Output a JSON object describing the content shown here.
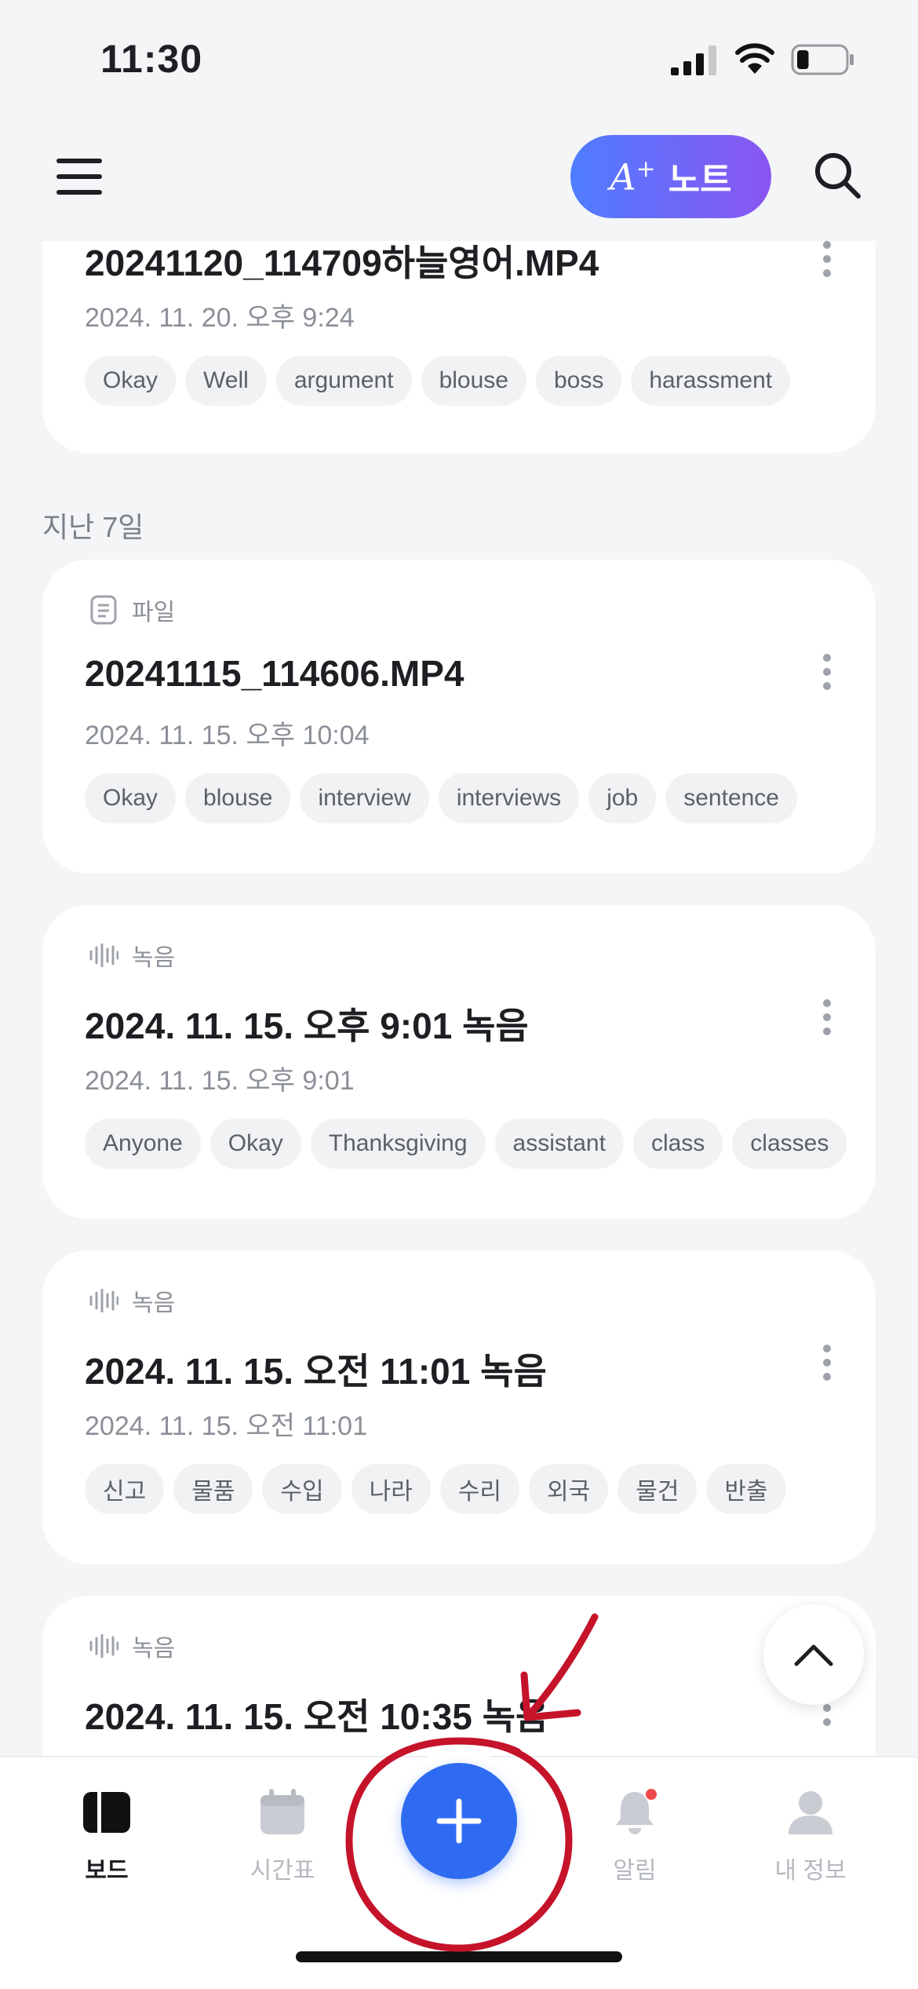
{
  "status_bar": {
    "time": "11:30",
    "battery_level": 0.25
  },
  "header": {
    "menu_icon": "hamburger-icon",
    "anote_button": {
      "prefix": "A",
      "sup": "+",
      "label": "노트"
    },
    "search_icon": "search-icon"
  },
  "cards": [
    {
      "type": "",
      "title": "20241120_114709하늘영어.MP4",
      "date": "2024. 11. 20. 오후 9:24",
      "tags": [
        "Okay",
        "Well",
        "argument",
        "blouse",
        "boss",
        "harassment"
      ]
    },
    {
      "type": "파일",
      "type_icon": "file-icon",
      "title": "20241115_114606.MP4",
      "date": "2024. 11. 15. 오후 10:04",
      "tags": [
        "Okay",
        "blouse",
        "interview",
        "interviews",
        "job",
        "sentence"
      ]
    },
    {
      "type": "녹음",
      "type_icon": "waveform-icon",
      "title": "2024. 11. 15. 오후 9:01 녹음",
      "date": "2024. 11. 15. 오후 9:01",
      "tags": [
        "Anyone",
        "Okay",
        "Thanksgiving",
        "assistant",
        "class",
        "classes"
      ]
    },
    {
      "type": "녹음",
      "type_icon": "waveform-icon",
      "title": "2024. 11. 15. 오전 11:01 녹음",
      "date": "2024. 11. 15. 오전 11:01",
      "tags": [
        "신고",
        "물품",
        "수입",
        "나라",
        "수리",
        "외국",
        "물건",
        "반출"
      ]
    },
    {
      "type": "녹음",
      "type_icon": "waveform-icon",
      "title": "2024. 11. 15. 오전 10:35 녹음",
      "date": "",
      "tags": []
    }
  ],
  "section_label": "지난 7일",
  "tabbar": {
    "tabs": [
      {
        "label": "보드",
        "icon": "board-icon",
        "active": true
      },
      {
        "label": "시간표",
        "icon": "calendar-icon",
        "active": false
      },
      {
        "label": "알림",
        "icon": "bell-icon",
        "active": false,
        "badge": true
      },
      {
        "label": "내 정보",
        "icon": "profile-icon",
        "active": false
      }
    ],
    "fab_icon": "plus-icon"
  },
  "colors": {
    "accent": "#2f6bf0",
    "gradient_start": "#4f7dff",
    "gradient_end": "#8a55f2",
    "annotation_red": "#c5132a",
    "badge_red": "#ef4a4a"
  }
}
